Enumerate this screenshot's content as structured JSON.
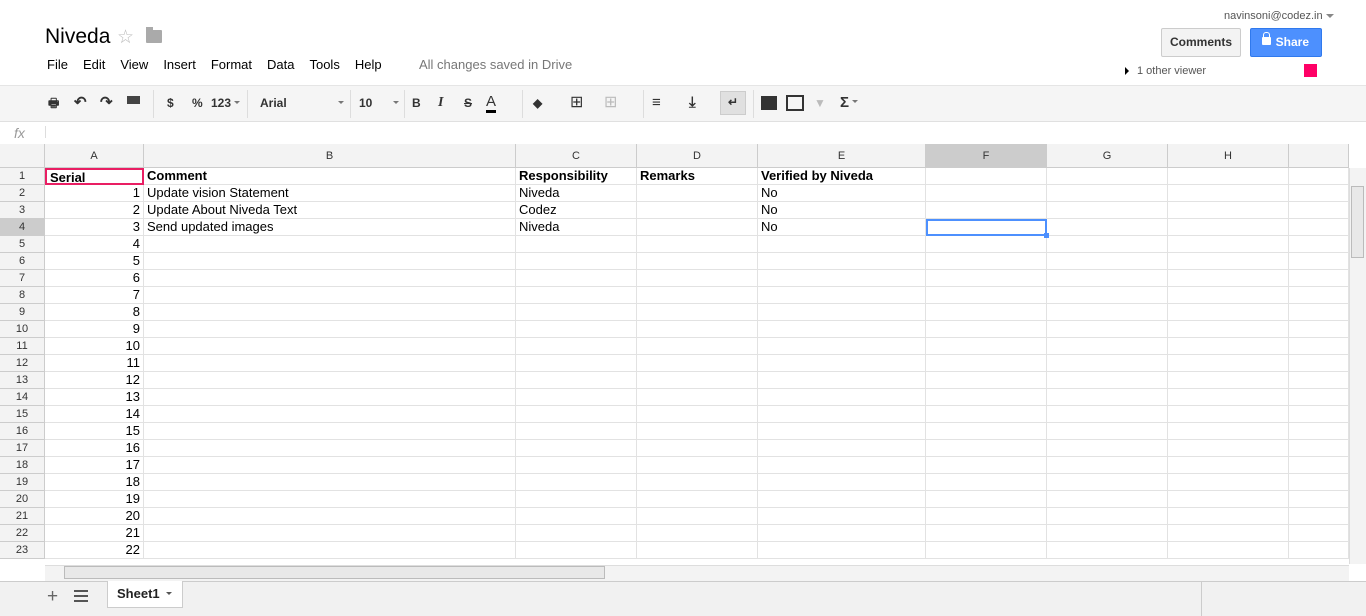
{
  "doc": {
    "title": "Niveda",
    "saved_status": "All changes saved in Drive"
  },
  "menu": [
    "File",
    "Edit",
    "View",
    "Insert",
    "Format",
    "Data",
    "Tools",
    "Help"
  ],
  "account": {
    "email": "navinsoni@codez.in",
    "comments_label": "Comments",
    "share_label": "Share",
    "viewers": "1 other viewer",
    "viewer_color": "#ff0066"
  },
  "toolbar": {
    "currency": "$",
    "percent": "%",
    "number_format": "123",
    "font": "Arial",
    "font_size": "10",
    "bold": "B",
    "italic": "I",
    "strike": "S",
    "text_color": "A",
    "functions": "Σ"
  },
  "formula_bar": {
    "label": "fx",
    "value": ""
  },
  "grid": {
    "columns": [
      "A",
      "B",
      "C",
      "D",
      "E",
      "F",
      "G",
      "H"
    ],
    "active_cell": "F4",
    "rows": [
      [
        "Serial",
        "Comment",
        "Responsibility",
        "Remarks",
        "Verified by Niveda",
        "",
        "",
        ""
      ],
      [
        "1",
        "Update vision Statement",
        "Niveda",
        "",
        "No",
        "",
        "",
        ""
      ],
      [
        "2",
        "Update About Niveda Text",
        "Codez",
        "",
        "No",
        "",
        "",
        ""
      ],
      [
        "3",
        "Send updated images",
        "Niveda",
        "",
        "No",
        "",
        "",
        ""
      ],
      [
        "4",
        "",
        "",
        "",
        "",
        "",
        "",
        ""
      ],
      [
        "5",
        "",
        "",
        "",
        "",
        "",
        "",
        ""
      ],
      [
        "6",
        "",
        "",
        "",
        "",
        "",
        "",
        ""
      ],
      [
        "7",
        "",
        "",
        "",
        "",
        "",
        "",
        ""
      ],
      [
        "8",
        "",
        "",
        "",
        "",
        "",
        "",
        ""
      ],
      [
        "9",
        "",
        "",
        "",
        "",
        "",
        "",
        ""
      ],
      [
        "10",
        "",
        "",
        "",
        "",
        "",
        "",
        ""
      ],
      [
        "11",
        "",
        "",
        "",
        "",
        "",
        "",
        ""
      ],
      [
        "12",
        "",
        "",
        "",
        "",
        "",
        "",
        ""
      ],
      [
        "13",
        "",
        "",
        "",
        "",
        "",
        "",
        ""
      ],
      [
        "14",
        "",
        "",
        "",
        "",
        "",
        "",
        ""
      ],
      [
        "15",
        "",
        "",
        "",
        "",
        "",
        "",
        ""
      ],
      [
        "16",
        "",
        "",
        "",
        "",
        "",
        "",
        ""
      ],
      [
        "17",
        "",
        "",
        "",
        "",
        "",
        "",
        ""
      ],
      [
        "18",
        "",
        "",
        "",
        "",
        "",
        "",
        ""
      ],
      [
        "19",
        "",
        "",
        "",
        "",
        "",
        "",
        ""
      ],
      [
        "20",
        "",
        "",
        "",
        "",
        "",
        "",
        ""
      ],
      [
        "21",
        "",
        "",
        "",
        "",
        "",
        "",
        ""
      ],
      [
        "22",
        "",
        "",
        "",
        "",
        "",
        "",
        ""
      ]
    ]
  },
  "sheets": [
    {
      "name": "Sheet1"
    }
  ]
}
